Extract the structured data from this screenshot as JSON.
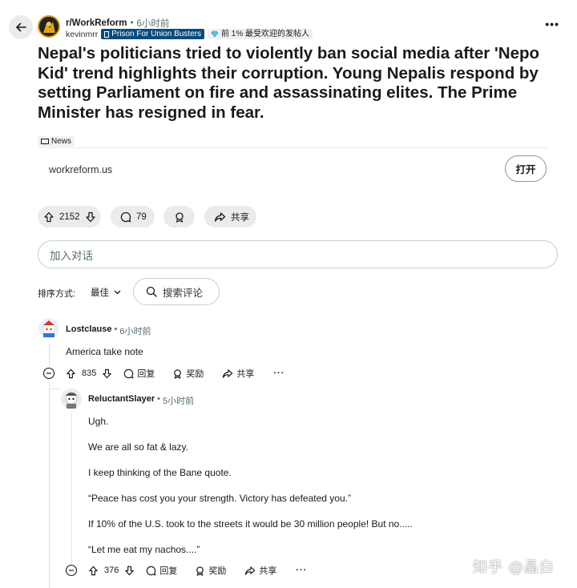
{
  "header": {
    "subreddit": "r/WorkReform",
    "post_time": "6小时前",
    "author": "kevinmrr",
    "user_flair": "Prison For Union Busters",
    "achievement_badge": "前 1% 最受欢迎的发帖人"
  },
  "post": {
    "title": "Nepal's politicians tried to violently ban social media after 'Nepo Kid' trend highlights their corruption. Young Nepalis respond by setting Parliament on fire and assassinating elites. The Prime Minister has resigned in fear.",
    "tag": "News",
    "link_domain": "workreform.us",
    "open_label": "打开",
    "votes": "2152",
    "comments": "79",
    "share_label": "共享"
  },
  "comment_box": {
    "placeholder": "加入对话"
  },
  "sort": {
    "label": "排序方式:",
    "value": "最佳",
    "search_label": "搜索评论"
  },
  "comments": [
    {
      "user": "Lostclause",
      "time": "6小时前",
      "lines": [
        "America take note"
      ],
      "votes": "835",
      "reply_label": "回复",
      "award_label": "奖励",
      "share_label": "共享"
    },
    {
      "user": "ReluctantSlayer",
      "time": "5小时前",
      "lines": [
        "Ugh.",
        "We are all so fat & lazy.",
        "I keep thinking of the Bane quote.",
        "“Peace has cost you your strength. Victory has defeated you.”",
        "If 10% of the U.S. took to the streets it would be 30 million people! But no.....",
        "“Let me eat my nachos....”"
      ],
      "votes": "376",
      "reply_label": "回复",
      "award_label": "奖励",
      "share_label": "共享"
    }
  ],
  "watermark": "知乎 @晶白",
  "colors": {
    "flair_bg": "#0b4b7c",
    "pill_bg": "#e9ebed",
    "text": "#1a1a1b",
    "muted": "#576f76"
  }
}
